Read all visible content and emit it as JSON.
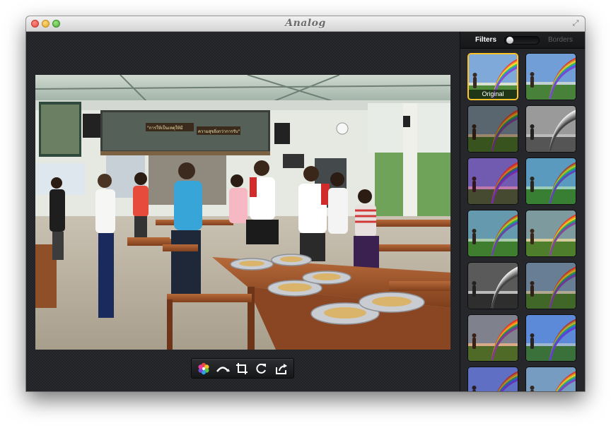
{
  "window": {
    "title": "Analog"
  },
  "sidebar": {
    "segment": {
      "left_label": "Filters",
      "right_label": "Borders",
      "selected": "Filters"
    },
    "thumbnails": [
      {
        "caption": "Original",
        "selected": true,
        "tint": "none"
      },
      {
        "caption": "",
        "selected": false,
        "tint": "vivid"
      },
      {
        "caption": "",
        "selected": false,
        "tint": "sepia"
      },
      {
        "caption": "",
        "selected": false,
        "tint": "mono"
      },
      {
        "caption": "",
        "selected": false,
        "tint": "magenta"
      },
      {
        "caption": "",
        "selected": false,
        "tint": "teal"
      },
      {
        "caption": "",
        "selected": false,
        "tint": "green"
      },
      {
        "caption": "",
        "selected": false,
        "tint": "warm"
      },
      {
        "caption": "",
        "selected": false,
        "tint": "mono-dark"
      },
      {
        "caption": "",
        "selected": false,
        "tint": "vintage"
      },
      {
        "caption": "",
        "selected": false,
        "tint": "light-leak"
      },
      {
        "caption": "",
        "selected": false,
        "tint": "cool-blue"
      },
      {
        "caption": "",
        "selected": false,
        "tint": "purple"
      },
      {
        "caption": "",
        "selected": false,
        "tint": "faded"
      }
    ]
  },
  "toolbar": {
    "buttons": [
      {
        "name": "filters-wheel-icon",
        "label": "Filters"
      },
      {
        "name": "rotate-arc-icon",
        "label": "Straighten"
      },
      {
        "name": "crop-icon",
        "label": "Crop"
      },
      {
        "name": "rotate-icon",
        "label": "Rotate"
      },
      {
        "name": "share-icon",
        "label": "Share"
      }
    ]
  },
  "photo": {
    "signs": [
      "\"การให้เป็นเหตุให้มี",
      "ความสุขยิ่งกว่าการรับ\""
    ]
  },
  "colors": {
    "selection": "#ffc229",
    "window_bg": "#1b1c1e",
    "sidebar_bg": "#26272a"
  }
}
